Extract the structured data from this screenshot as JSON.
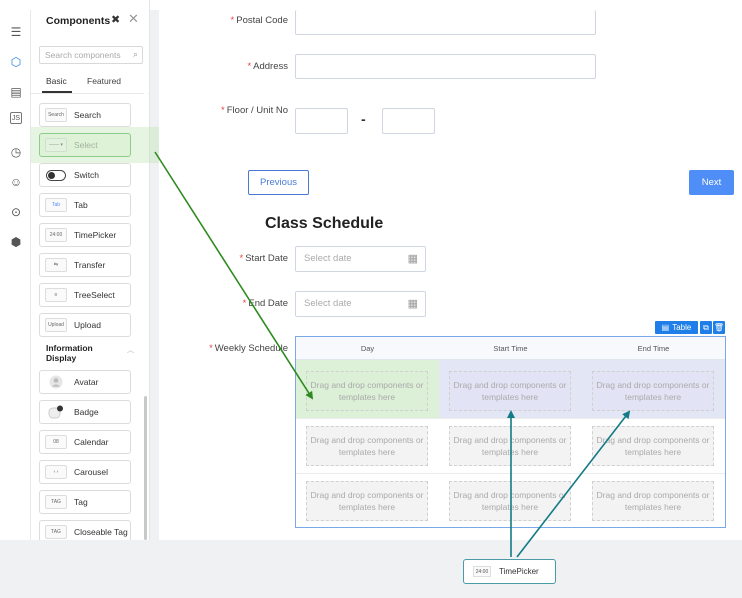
{
  "panel": {
    "title": "Components",
    "search_placeholder": "Search components",
    "tabs": [
      "Basic",
      "Featured"
    ],
    "basic_items": [
      {
        "label": "Search",
        "icon": "search-component-icon",
        "glyph": "Search"
      },
      {
        "label": "Select",
        "icon": "select-component-icon",
        "glyph": "—— ▾"
      },
      {
        "label": "Switch",
        "icon": "switch-component-icon",
        "glyph": ""
      },
      {
        "label": "Tab",
        "icon": "tab-component-icon",
        "glyph": "Tab"
      },
      {
        "label": "TimePicker",
        "icon": "timepicker-component-icon",
        "glyph": "24:00"
      },
      {
        "label": "Transfer",
        "icon": "transfer-component-icon",
        "glyph": "⇆"
      },
      {
        "label": "TreeSelect",
        "icon": "treeselect-component-icon",
        "glyph": "≡"
      },
      {
        "label": "Upload",
        "icon": "upload-component-icon",
        "glyph": "Upload"
      }
    ],
    "section_title": "Information Display",
    "info_items": [
      {
        "label": "Avatar",
        "icon": "avatar-component-icon",
        "glyph": "●"
      },
      {
        "label": "Badge",
        "icon": "badge-component-icon",
        "glyph": "●"
      },
      {
        "label": "Calendar",
        "icon": "calendar-component-icon",
        "glyph": "08"
      },
      {
        "label": "Carousel",
        "icon": "carousel-component-icon",
        "glyph": "‹ ›"
      },
      {
        "label": "Tag",
        "icon": "tag-component-icon",
        "glyph": "TAG"
      },
      {
        "label": "Closeable Tag",
        "icon": "closeable-tag-component-icon",
        "glyph": "TAG"
      }
    ]
  },
  "form": {
    "postal_code_label": "Postal Code",
    "address_label": "Address",
    "floor_label": "Floor / Unit No",
    "floor_separator": "-",
    "previous_label": "Previous",
    "next_label": "Next",
    "section_title": "Class Schedule",
    "start_date_label": "Start Date",
    "start_date_placeholder": "Select date",
    "end_date_label": "End Date",
    "end_date_placeholder": "Select date",
    "weekly_schedule_label": "Weekly Schedule",
    "required_mark": "*"
  },
  "table": {
    "badge_label": "Table",
    "columns": [
      "Day",
      "Start Time",
      "End Time"
    ],
    "drop_text": "Drag and drop components or templates here"
  },
  "drag_preview": {
    "label": "TimePicker",
    "glyph": "24:00"
  },
  "colors": {
    "accent": "#4f8ef7",
    "required": "#e54545",
    "drag_arrow_green": "#2e8b1f",
    "drag_arrow_teal": "#137a86"
  }
}
